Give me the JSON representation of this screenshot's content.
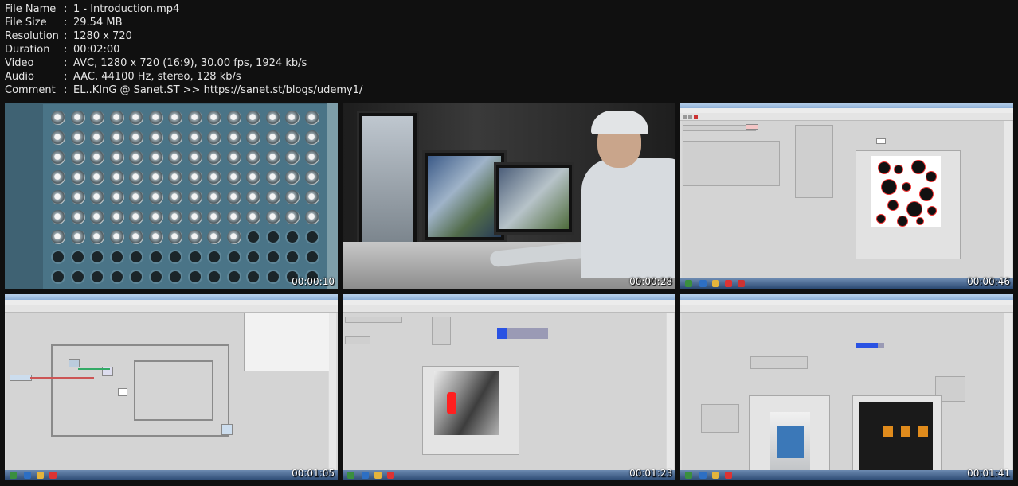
{
  "info": [
    {
      "key": "File Name",
      "value": "1 - Introduction.mp4"
    },
    {
      "key": "File Size",
      "value": "29.54 MB"
    },
    {
      "key": "Resolution",
      "value": "1280 x 720"
    },
    {
      "key": "Duration",
      "value": "00:02:00"
    },
    {
      "key": "Video",
      "value": "AVC, 1280 x 720 (16:9), 30.00 fps, 1924 kb/s"
    },
    {
      "key": "Audio",
      "value": "AAC, 44100 Hz, stereo, 128 kb/s"
    },
    {
      "key": "Comment",
      "value": "EL..KInG @ Sanet.ST >> https://sanet.st/blogs/udemy1/"
    }
  ],
  "separator": ":",
  "thumbs": [
    {
      "timestamp": "00:00:10"
    },
    {
      "timestamp": "00:00:28"
    },
    {
      "timestamp": "00:00:46"
    },
    {
      "timestamp": "00:01:05"
    },
    {
      "timestamp": "00:01:23"
    },
    {
      "timestamp": "00:01:41"
    }
  ]
}
